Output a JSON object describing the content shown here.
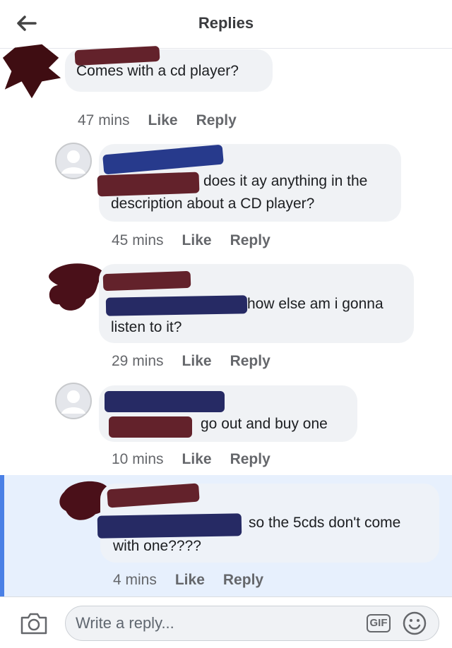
{
  "header": {
    "title": "Replies",
    "back_icon": "arrow-left-icon"
  },
  "comments": [
    {
      "text": "Comes with a cd player?",
      "time": "47 mins",
      "like": "Like",
      "reply": "Reply"
    },
    {
      "text_line1": "does it ay anything in the",
      "text_line2": "description about a CD player?",
      "time": "45 mins",
      "like": "Like",
      "reply": "Reply"
    },
    {
      "text_line1": "how else am i gonna",
      "text_line2": "listen to it?",
      "time": "29 mins",
      "like": "Like",
      "reply": "Reply"
    },
    {
      "text": "go out and buy one",
      "time": "10 mins",
      "like": "Like",
      "reply": "Reply"
    },
    {
      "text_line1": "so the 5cds don't come",
      "text_line2": "with one????",
      "time": "4 mins",
      "like": "Like",
      "reply": "Reply",
      "highlighted": true
    }
  ],
  "composer": {
    "placeholder": "Write a reply...",
    "gif_label": "GIF",
    "camera_icon": "camera-icon",
    "emoji_icon": "smiley-icon"
  },
  "colors": {
    "bubble": "#f0f2f5",
    "highlight": "#e7f0fd",
    "highlight_border": "#4a80e6",
    "meta_text": "#65676b"
  }
}
